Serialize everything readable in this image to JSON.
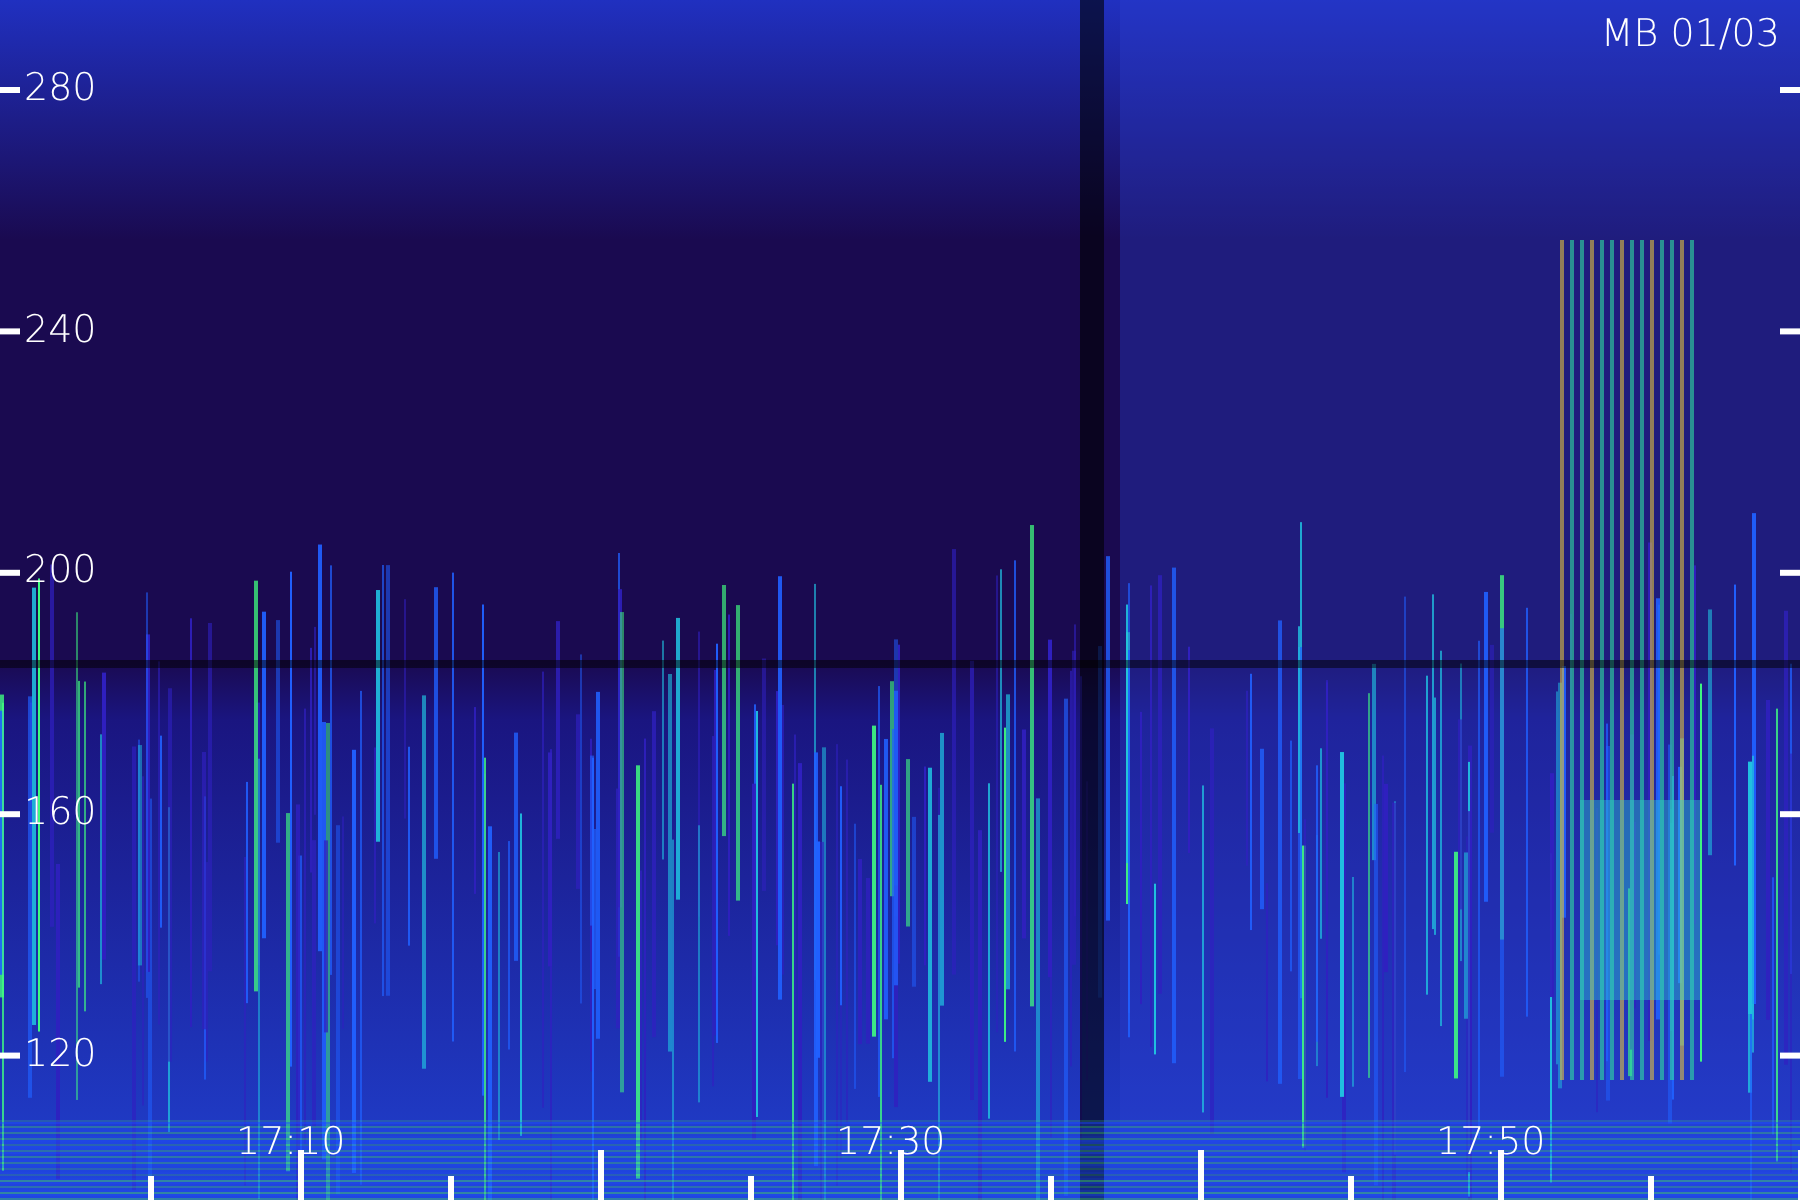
{
  "title": "MB 01/03",
  "y_axis": {
    "labels": [
      "280",
      "240",
      "200",
      "160",
      "120"
    ]
  },
  "x_axis": {
    "labels": [
      "17:10",
      "17:30",
      "17:50"
    ]
  }
}
